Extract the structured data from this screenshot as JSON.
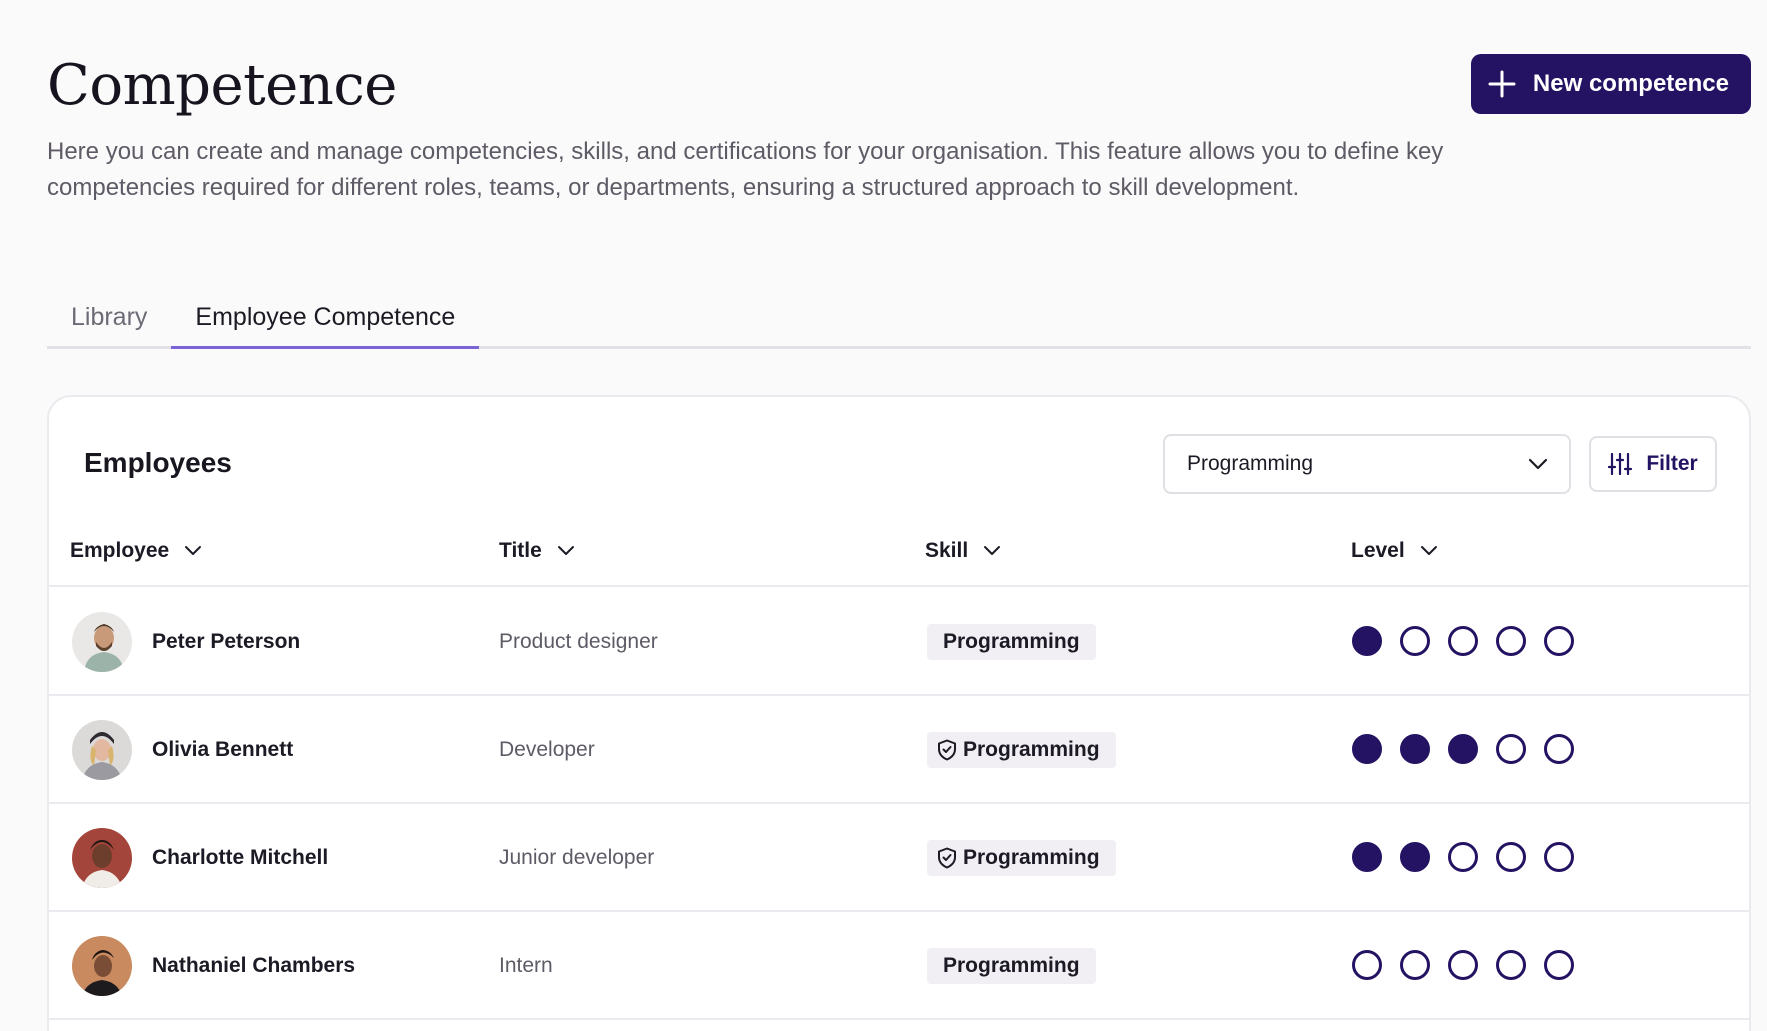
{
  "header": {
    "title": "Competence",
    "description": "Here you can create and manage competencies, skills, and certifications for your organisation. This feature allows you to define key competencies required for different roles, teams, or departments, ensuring a structured approach to skill development.",
    "new_button_label": "New competence"
  },
  "tabs": [
    {
      "label": "Library",
      "active": false
    },
    {
      "label": "Employee Competence",
      "active": true
    }
  ],
  "card": {
    "title": "Employees",
    "skill_select": {
      "value": "Programming"
    },
    "filter_label": "Filter"
  },
  "table": {
    "columns": [
      "Employee",
      "Title",
      "Skill",
      "Level"
    ],
    "rows": [
      {
        "name": "Peter Peterson",
        "title": "Product designer",
        "skill": "Programming",
        "verified": false,
        "level": 1,
        "max_level": 5
      },
      {
        "name": "Olivia Bennett",
        "title": "Developer",
        "skill": "Programming",
        "verified": true,
        "level": 3,
        "max_level": 5
      },
      {
        "name": "Charlotte Mitchell",
        "title": "Junior developer",
        "skill": "Programming",
        "verified": true,
        "level": 2,
        "max_level": 5
      },
      {
        "name": "Nathaniel Chambers",
        "title": "Intern",
        "skill": "Programming",
        "verified": false,
        "level": 0,
        "max_level": 5
      }
    ]
  },
  "colors": {
    "brand": "#241262",
    "tab_underline": "#7b64d6"
  },
  "icons": {
    "new_button": "plus-icon",
    "select": "chevron-down-icon",
    "filter": "sliders-icon",
    "verified": "shield-check-icon"
  }
}
